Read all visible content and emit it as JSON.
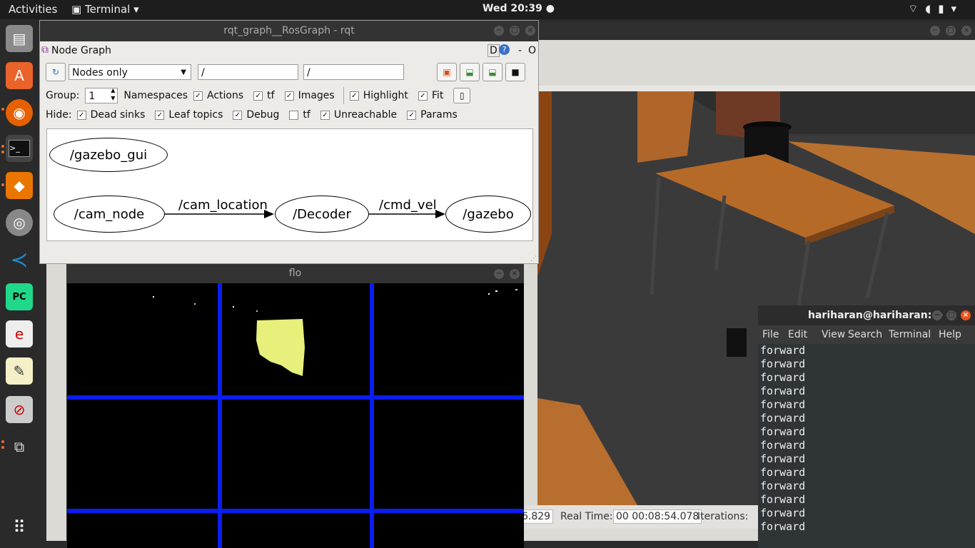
{
  "topbar": {
    "activities": "Activities",
    "app": "Terminal",
    "clock": "Wed 20:39"
  },
  "dock": {
    "items": [
      "files-icon",
      "software-icon",
      "firefox-icon",
      "terminal-icon",
      "blender-icon",
      "gimp-icon",
      "vscode-icon",
      "pycharm-icon",
      "sublime-icon",
      "editor-icon",
      "record-icon",
      "network-icon",
      "apps-grid-icon"
    ]
  },
  "rqt": {
    "title": "rqt_graph__RosGraph - rqt",
    "plugin": "Node Graph",
    "plugin_right": "D",
    "help": "?",
    "dash": "-",
    "o": "O",
    "mode": "Nodes only",
    "filter1": "/",
    "filter2": "/",
    "group_label": "Group:",
    "group_value": "1",
    "options": [
      {
        "label": "Namespaces",
        "checked": false
      },
      {
        "label": "Actions",
        "checked": true
      },
      {
        "label": "tf",
        "checked": true
      },
      {
        "label": "Images",
        "checked": true
      },
      {
        "label": "Highlight",
        "checked": true
      },
      {
        "label": "Fit",
        "checked": true
      }
    ],
    "hide_label": "Hide:",
    "hide": [
      {
        "label": "Dead sinks",
        "checked": true
      },
      {
        "label": "Leaf topics",
        "checked": true
      },
      {
        "label": "Debug",
        "checked": true
      },
      {
        "label": "tf",
        "checked": false
      },
      {
        "label": "Unreachable",
        "checked": true
      },
      {
        "label": "Params",
        "checked": true
      }
    ],
    "nodes": {
      "gazebo_gui": "/gazebo_gui",
      "cam_node": "/cam_node",
      "decoder": "/Decoder",
      "gazebo": "/gazebo"
    },
    "edges": {
      "cam_location": "/cam_location",
      "cmd_vel": "/cmd_vel"
    }
  },
  "flo": {
    "title": "flo"
  },
  "gazebo": {
    "prefix": "6.829",
    "real_time_label": "Real Time:",
    "real_time": "00 00:08:54.078",
    "iterations_label": "Iterations:"
  },
  "terminal": {
    "title": "hariharan@hariharan: ~",
    "menu": [
      "File",
      "Edit",
      "View",
      "Search",
      "Terminal",
      "Help"
    ],
    "lines": [
      "forward",
      "forward",
      "forward",
      "forward",
      "forward",
      "forward",
      "forward",
      "forward",
      "forward",
      "forward",
      "forward",
      "forward",
      "forward",
      "forward"
    ]
  }
}
